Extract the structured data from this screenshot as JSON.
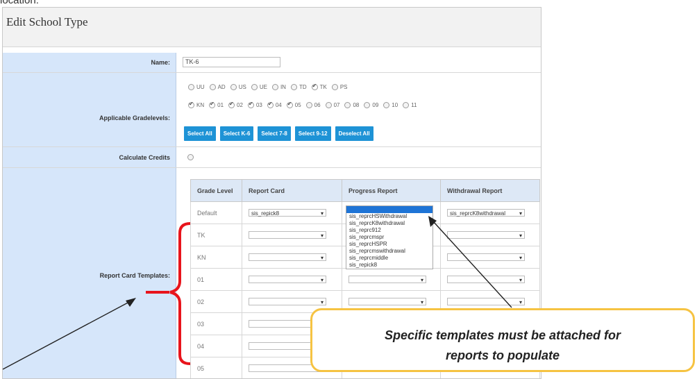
{
  "cropped_text": "location:",
  "title": "Edit School Type",
  "name": {
    "label": "Name:",
    "value": "TK-6"
  },
  "gradelevels": {
    "label": "Applicable Gradelevels:",
    "row1": [
      {
        "code": "UU",
        "checked": false
      },
      {
        "code": "AD",
        "checked": false
      },
      {
        "code": "US",
        "checked": false
      },
      {
        "code": "UE",
        "checked": false
      },
      {
        "code": "IN",
        "checked": false
      },
      {
        "code": "TD",
        "checked": false
      },
      {
        "code": "TK",
        "checked": true
      },
      {
        "code": "PS",
        "checked": false
      }
    ],
    "row2": [
      {
        "code": "KN",
        "checked": true
      },
      {
        "code": "01",
        "checked": true
      },
      {
        "code": "02",
        "checked": true
      },
      {
        "code": "03",
        "checked": true
      },
      {
        "code": "04",
        "checked": true
      },
      {
        "code": "05",
        "checked": true
      },
      {
        "code": "06",
        "checked": false
      },
      {
        "code": "07",
        "checked": false
      },
      {
        "code": "08",
        "checked": false
      },
      {
        "code": "09",
        "checked": false
      },
      {
        "code": "10",
        "checked": false
      },
      {
        "code": "11",
        "checked": false
      }
    ],
    "buttons": [
      "Select All",
      "Select K-6",
      "Select 7-8",
      "Select 9-12",
      "Deselect All"
    ]
  },
  "credits": {
    "label": "Calculate Credits"
  },
  "templates": {
    "label": "Report Card Templates:",
    "headers": [
      "Grade Level",
      "Report Card",
      "Progress Report",
      "Withdrawal Report"
    ],
    "rows": [
      {
        "grade": "Default",
        "report": "sis_repick8",
        "progress": "",
        "withdrawal": "sis_reprcK8withdrawal"
      },
      {
        "grade": "TK",
        "report": "",
        "progress": "",
        "withdrawal": ""
      },
      {
        "grade": "KN",
        "report": "",
        "progress": "",
        "withdrawal": ""
      },
      {
        "grade": "01",
        "report": "",
        "progress": "",
        "withdrawal": ""
      },
      {
        "grade": "02",
        "report": "",
        "progress": "",
        "withdrawal": ""
      },
      {
        "grade": "03",
        "report": "",
        "progress": "",
        "withdrawal": ""
      },
      {
        "grade": "04",
        "report": "",
        "progress": "",
        "withdrawal": ""
      },
      {
        "grade": "05",
        "report": "",
        "progress": "",
        "withdrawal": ""
      }
    ],
    "dropdown_options": [
      "sis_reprcHSWithdrawal",
      "sis_reprcK8withdrawal",
      "sis_reprc912",
      "sis_reprcmspr",
      "sis_reprcHSPR",
      "sis_reprcmswithdrawal",
      "sis_reprcmiddle",
      "sis_repick8"
    ]
  },
  "callout": {
    "line1": "Specific templates must be attached for",
    "line2": "reports to populate"
  },
  "colors": {
    "label_bg": "#d6e6fa",
    "button": "#1e93d6",
    "bracket": "#e8141c",
    "callout_border": "#f6c342"
  }
}
